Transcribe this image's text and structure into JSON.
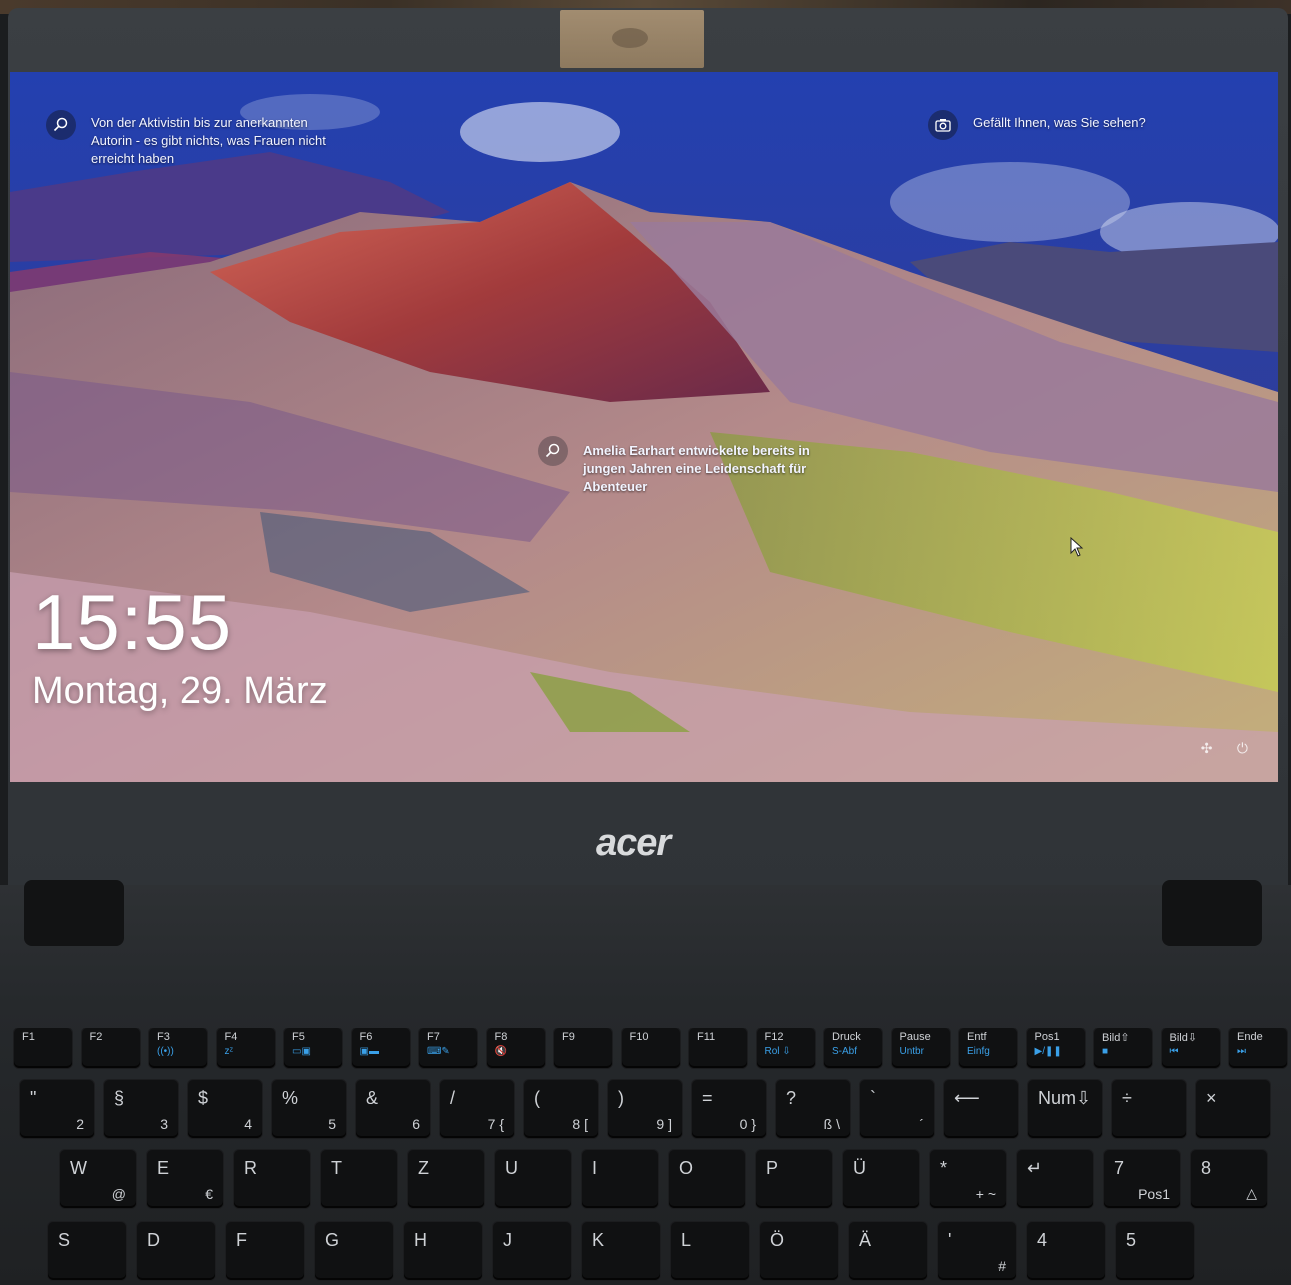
{
  "lockscreen": {
    "tip_top_left": "Von der Aktivistin bis zur anerkannten\nAutorin - es gibt nichts, was Frauen nicht\nerreicht haben",
    "like_prompt": "Gefällt Ihnen, was Sie sehen?",
    "tip_center": "Amelia Earhart entwickelte bereits in\njungen Jahren eine Leidenschaft für\nAbenteuer",
    "time": "15:55",
    "date": "Montag, 29. März"
  },
  "laptop": {
    "brand": "acer",
    "function_keys": [
      {
        "top": "F1",
        "sub": ""
      },
      {
        "top": "F2",
        "sub": ""
      },
      {
        "top": "F3",
        "sub": "((•))"
      },
      {
        "top": "F4",
        "sub": "zᶻ"
      },
      {
        "top": "F5",
        "sub": "▭▣"
      },
      {
        "top": "F6",
        "sub": "▣▬"
      },
      {
        "top": "F7",
        "sub": "⌨✎"
      },
      {
        "top": "F8",
        "sub": "🔇"
      },
      {
        "top": "F9",
        "sub": ""
      },
      {
        "top": "F10",
        "sub": ""
      },
      {
        "top": "F11",
        "sub": ""
      },
      {
        "top": "F12",
        "sub": "Rol ⇩"
      },
      {
        "top": "Druck",
        "sub": "S-Abf"
      },
      {
        "top": "Pause",
        "sub": "Untbr"
      },
      {
        "top": "Entf",
        "sub": "Einfg"
      },
      {
        "top": "Pos1",
        "sub": "▶/❚❚"
      },
      {
        "top": "Bild⇧",
        "sub": "■"
      },
      {
        "top": "Bild⇩",
        "sub": "⏮"
      },
      {
        "top": "Ende",
        "sub": "⏭"
      }
    ],
    "number_row": [
      {
        "top": "\"",
        "bottom": "2"
      },
      {
        "top": "§",
        "bottom": "3"
      },
      {
        "top": "$",
        "bottom": "4"
      },
      {
        "top": "%",
        "bottom": "5"
      },
      {
        "top": "&",
        "bottom": "6"
      },
      {
        "top": "/",
        "bottom": "7 {"
      },
      {
        "top": "(",
        "bottom": "8 ["
      },
      {
        "top": ")",
        "bottom": "9 ]"
      },
      {
        "top": "=",
        "bottom": "0 }"
      },
      {
        "top": "?",
        "bottom": "ß \\"
      },
      {
        "top": "`",
        "bottom": "´"
      },
      {
        "top": "⟵",
        "bottom": ""
      },
      {
        "top": "Num⇩",
        "bottom": ""
      },
      {
        "top": "÷",
        "bottom": ""
      },
      {
        "top": "×",
        "bottom": ""
      }
    ],
    "qwertz_row": [
      {
        "top": "W",
        "bottom": "@"
      },
      {
        "top": "E",
        "bottom": "€"
      },
      {
        "top": "R",
        "bottom": ""
      },
      {
        "top": "T",
        "bottom": ""
      },
      {
        "top": "Z",
        "bottom": ""
      },
      {
        "top": "U",
        "bottom": ""
      },
      {
        "top": "I",
        "bottom": ""
      },
      {
        "top": "O",
        "bottom": ""
      },
      {
        "top": "P",
        "bottom": ""
      },
      {
        "top": "Ü",
        "bottom": ""
      },
      {
        "top": "*",
        "bottom": "+ ~"
      },
      {
        "top": "↵",
        "bottom": ""
      },
      {
        "top": "7",
        "bottom": "Pos1"
      },
      {
        "top": "8",
        "bottom": "△"
      }
    ],
    "asdf_row": [
      {
        "top": "S",
        "bottom": ""
      },
      {
        "top": "D",
        "bottom": ""
      },
      {
        "top": "F",
        "bottom": ""
      },
      {
        "top": "G",
        "bottom": ""
      },
      {
        "top": "H",
        "bottom": ""
      },
      {
        "top": "J",
        "bottom": ""
      },
      {
        "top": "K",
        "bottom": ""
      },
      {
        "top": "L",
        "bottom": ""
      },
      {
        "top": "Ö",
        "bottom": ""
      },
      {
        "top": "Ä",
        "bottom": ""
      },
      {
        "top": "'",
        "bottom": "#"
      },
      {
        "top": "4",
        "bottom": ""
      },
      {
        "top": "5",
        "bottom": ""
      }
    ]
  },
  "colors": {
    "sky": "#2a3a9a",
    "cloud": "#dfe6f7",
    "mountain_red": "#a23b3c",
    "meadow_green": "#b5c24a"
  }
}
